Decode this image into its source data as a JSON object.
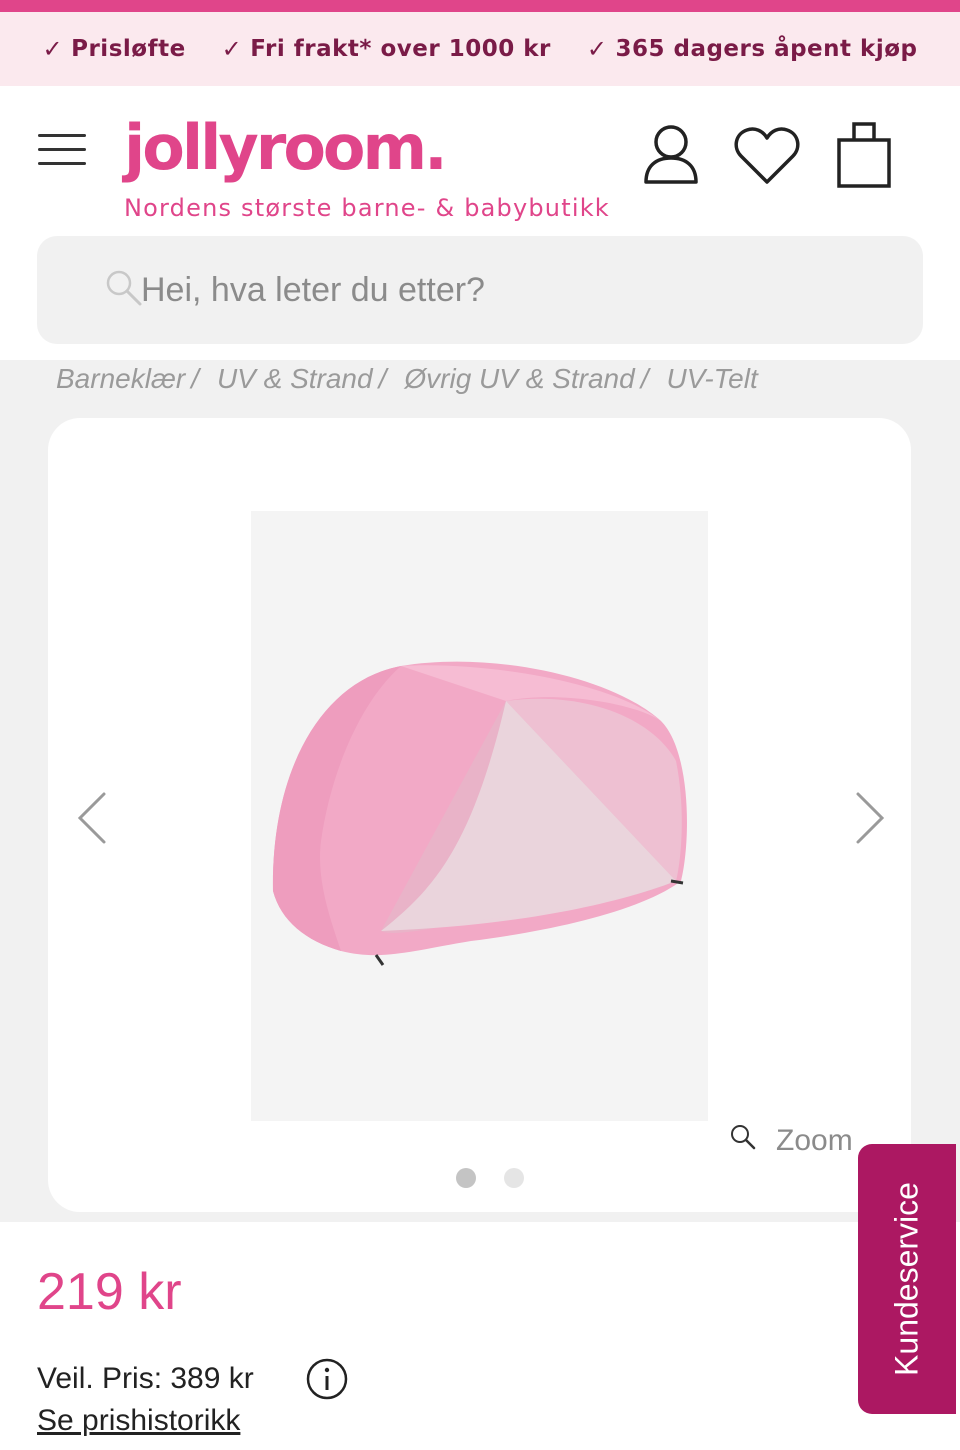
{
  "usp": [
    {
      "check": "✓",
      "text": "Prisløfte"
    },
    {
      "check": "✓",
      "text": "Fri frakt* over 1000 kr"
    },
    {
      "check": "✓",
      "text": "365 dagers åpent kjøp"
    }
  ],
  "header": {
    "logo": "jollyroom.",
    "tagline": "Nordens største barne- & babybutikk"
  },
  "search": {
    "placeholder": "Hei, hva leter du etter?"
  },
  "breadcrumb": [
    "Barneklær",
    "UV & Strand",
    "Øvrig UV & Strand",
    "UV-Telt"
  ],
  "breadcrumb_sep": "/",
  "gallery": {
    "zoom_label": "Zoom",
    "image_count": 2,
    "active_index": 0
  },
  "product": {
    "price": "219 kr",
    "rrp": "Veil. Pris: 389 kr",
    "history_link": "Se prishistorikk"
  },
  "kundeservice": "Kundeservice",
  "colors": {
    "brand_pink": "#e0458a",
    "usp_bg": "#fbe9ee",
    "usp_text": "#7a1b47",
    "kundeservice_bg": "#ac1862",
    "tent_pink": "#f2a9c6"
  }
}
